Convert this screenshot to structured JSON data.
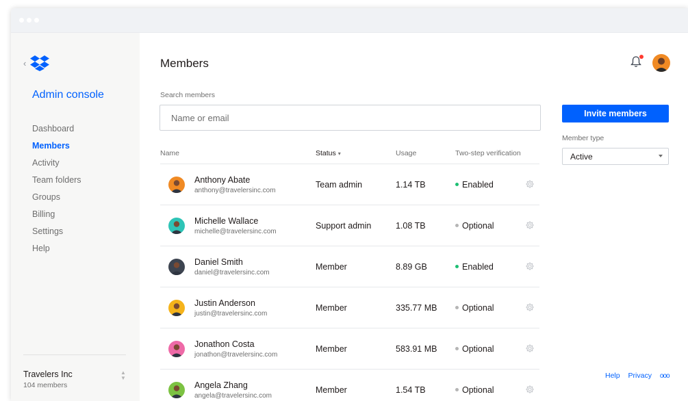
{
  "colors": {
    "accent": "#0061fe",
    "enabled": "#1dbf73",
    "optional": "#b5b5b5",
    "notification": "#ff3b30"
  },
  "sidebar": {
    "back_icon": "chevron-left-icon",
    "logo_icon": "dropbox-logo-icon",
    "title": "Admin console",
    "items": [
      {
        "label": "Dashboard",
        "active": false
      },
      {
        "label": "Members",
        "active": true
      },
      {
        "label": "Activity",
        "active": false
      },
      {
        "label": "Team folders",
        "active": false
      },
      {
        "label": "Groups",
        "active": false
      },
      {
        "label": "Billing",
        "active": false
      },
      {
        "label": "Settings",
        "active": false
      },
      {
        "label": "Help",
        "active": false
      }
    ],
    "org": {
      "name": "Travelers Inc",
      "count": "104 members"
    }
  },
  "header": {
    "title": "Members",
    "bell_icon": "bell-icon",
    "has_notification": true
  },
  "search": {
    "label": "Search members",
    "placeholder": "Name or email",
    "value": ""
  },
  "table": {
    "columns": {
      "name": "Name",
      "status": "Status",
      "usage": "Usage",
      "verify": "Two-step verification"
    },
    "rows": [
      {
        "name": "Anthony Abate",
        "email": "anthony@travelersinc.com",
        "status": "Team admin",
        "usage": "1.14 TB",
        "verification": "Enabled",
        "avatar_color": "#f08a24"
      },
      {
        "name": "Michelle Wallace",
        "email": "michelle@travelersinc.com",
        "status": "Support admin",
        "usage": "1.08 TB",
        "verification": "Optional",
        "avatar_color": "#2ec4b6"
      },
      {
        "name": "Daniel Smith",
        "email": "daniel@travelersinc.com",
        "status": "Member",
        "usage": "8.89 GB",
        "verification": "Enabled",
        "avatar_color": "#3d4450"
      },
      {
        "name": "Justin Anderson",
        "email": "justin@travelersinc.com",
        "status": "Member",
        "usage": "335.77 MB",
        "verification": "Optional",
        "avatar_color": "#f5b31b"
      },
      {
        "name": "Jonathon Costa",
        "email": "jonathon@travelersinc.com",
        "status": "Member",
        "usage": "583.91 MB",
        "verification": "Optional",
        "avatar_color": "#ee6aa7"
      },
      {
        "name": "Angela Zhang",
        "email": "angela@travelersinc.com",
        "status": "Member",
        "usage": "1.54 TB",
        "verification": "Optional",
        "avatar_color": "#7cc242"
      }
    ]
  },
  "actions": {
    "invite_label": "Invite members",
    "member_type_label": "Member type",
    "member_type_value": "Active"
  },
  "footer": {
    "help": "Help",
    "privacy": "Privacy",
    "more": "ooo"
  }
}
